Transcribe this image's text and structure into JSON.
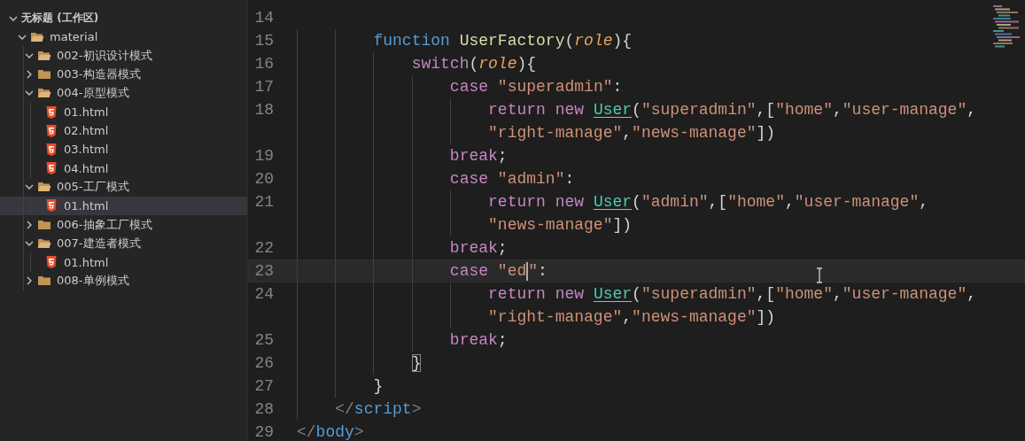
{
  "explorer": {
    "workspace": {
      "label": "无标题 (工作区)",
      "expanded": true,
      "children": [
        {
          "kind": "folder",
          "label": "material",
          "expanded": true,
          "selected": false,
          "children": [
            {
              "kind": "folder",
              "label": "002-初识设计模式",
              "expanded": true,
              "selected": false
            },
            {
              "kind": "folder",
              "label": "003-构造器模式",
              "expanded": false,
              "selected": false
            },
            {
              "kind": "folder",
              "label": "004-原型模式",
              "expanded": true,
              "selected": false,
              "children": [
                {
                  "kind": "file",
                  "label": "01.html",
                  "selected": false
                },
                {
                  "kind": "file",
                  "label": "02.html",
                  "selected": false
                },
                {
                  "kind": "file",
                  "label": "03.html",
                  "selected": false
                },
                {
                  "kind": "file",
                  "label": "04.html",
                  "selected": false
                }
              ]
            },
            {
              "kind": "folder",
              "label": "005-工厂模式",
              "expanded": true,
              "selected": false,
              "children": [
                {
                  "kind": "file",
                  "label": "01.html",
                  "selected": true
                }
              ]
            },
            {
              "kind": "folder",
              "label": "006-抽象工厂模式",
              "expanded": false,
              "selected": false
            },
            {
              "kind": "folder",
              "label": "007-建造者模式",
              "expanded": true,
              "selected": false,
              "children": [
                {
                  "kind": "file",
                  "label": "01.html",
                  "selected": false
                }
              ]
            },
            {
              "kind": "folder",
              "label": "008-单例模式",
              "expanded": false,
              "selected": false
            }
          ]
        }
      ]
    }
  },
  "editor": {
    "lines": [
      {
        "number": "14",
        "current": false,
        "rows": [
          {
            "tokens": []
          }
        ]
      },
      {
        "number": "15",
        "current": false,
        "rows": [
          {
            "tokens": [
              {
                "text": "        function ",
                "kind": "keyword"
              },
              {
                "text": "UserFactory",
                "kind": "function"
              },
              {
                "text": "(",
                "kind": "plain"
              },
              {
                "text": "role",
                "kind": "param"
              },
              {
                "text": "){",
                "kind": "plain"
              }
            ]
          }
        ]
      },
      {
        "number": "16",
        "current": false,
        "rows": [
          {
            "tokens": [
              {
                "text": "            switch",
                "kind": "control"
              },
              {
                "text": "(",
                "kind": "plain"
              },
              {
                "text": "role",
                "kind": "param"
              },
              {
                "text": "){",
                "kind": "plain"
              }
            ]
          }
        ]
      },
      {
        "number": "17",
        "current": false,
        "rows": [
          {
            "tokens": [
              {
                "text": "                case ",
                "kind": "control"
              },
              {
                "text": "\"superadmin\"",
                "kind": "string"
              },
              {
                "text": ":",
                "kind": "plain"
              }
            ]
          }
        ]
      },
      {
        "number": "18",
        "current": false,
        "rows": [
          {
            "tokens": [
              {
                "text": "                    return ",
                "kind": "control"
              },
              {
                "text": "new ",
                "kind": "control"
              },
              {
                "text": "User",
                "kind": "class"
              },
              {
                "text": "(",
                "kind": "plain"
              },
              {
                "text": "\"superadmin\"",
                "kind": "string"
              },
              {
                "text": ",[",
                "kind": "plain"
              },
              {
                "text": "\"home\"",
                "kind": "string"
              },
              {
                "text": ",",
                "kind": "plain"
              },
              {
                "text": "\"user-manage\"",
                "kind": "string"
              },
              {
                "text": ",",
                "kind": "plain"
              }
            ]
          },
          {
            "tokens": [
              {
                "text": "                    \"right-manage\"",
                "kind": "string"
              },
              {
                "text": ",",
                "kind": "plain"
              },
              {
                "text": "\"news-manage\"",
                "kind": "string"
              },
              {
                "text": "])",
                "kind": "plain"
              }
            ]
          }
        ]
      },
      {
        "number": "19",
        "current": false,
        "rows": [
          {
            "tokens": [
              {
                "text": "                break",
                "kind": "control"
              },
              {
                "text": ";",
                "kind": "plain"
              }
            ]
          }
        ]
      },
      {
        "number": "20",
        "current": false,
        "rows": [
          {
            "tokens": [
              {
                "text": "                case ",
                "kind": "control"
              },
              {
                "text": "\"admin\"",
                "kind": "string"
              },
              {
                "text": ":",
                "kind": "plain"
              }
            ]
          }
        ]
      },
      {
        "number": "21",
        "current": false,
        "rows": [
          {
            "tokens": [
              {
                "text": "                    return ",
                "kind": "control"
              },
              {
                "text": "new ",
                "kind": "control"
              },
              {
                "text": "User",
                "kind": "class"
              },
              {
                "text": "(",
                "kind": "plain"
              },
              {
                "text": "\"admin\"",
                "kind": "string"
              },
              {
                "text": ",[",
                "kind": "plain"
              },
              {
                "text": "\"home\"",
                "kind": "string"
              },
              {
                "text": ",",
                "kind": "plain"
              },
              {
                "text": "\"user-manage\"",
                "kind": "string"
              },
              {
                "text": ",",
                "kind": "plain"
              }
            ]
          },
          {
            "tokens": [
              {
                "text": "                    \"news-manage\"",
                "kind": "string"
              },
              {
                "text": "])",
                "kind": "plain"
              }
            ]
          }
        ]
      },
      {
        "number": "22",
        "current": false,
        "rows": [
          {
            "tokens": [
              {
                "text": "                break",
                "kind": "control"
              },
              {
                "text": ";",
                "kind": "plain"
              }
            ]
          }
        ]
      },
      {
        "number": "23",
        "current": true,
        "rows": [
          {
            "tokens": [
              {
                "text": "                case ",
                "kind": "control"
              },
              {
                "text": "\"ed",
                "kind": "string",
                "caret": true
              },
              {
                "text": "\"",
                "kind": "string"
              },
              {
                "text": ":",
                "kind": "plain"
              }
            ]
          }
        ]
      },
      {
        "number": "24",
        "current": false,
        "rows": [
          {
            "tokens": [
              {
                "text": "                    return ",
                "kind": "control"
              },
              {
                "text": "new ",
                "kind": "control"
              },
              {
                "text": "User",
                "kind": "class"
              },
              {
                "text": "(",
                "kind": "plain"
              },
              {
                "text": "\"superadmin\"",
                "kind": "string"
              },
              {
                "text": ",[",
                "kind": "plain"
              },
              {
                "text": "\"home\"",
                "kind": "string"
              },
              {
                "text": ",",
                "kind": "plain"
              },
              {
                "text": "\"user-manage\"",
                "kind": "string"
              },
              {
                "text": ",",
                "kind": "plain"
              }
            ]
          },
          {
            "tokens": [
              {
                "text": "                    \"right-manage\"",
                "kind": "string"
              },
              {
                "text": ",",
                "kind": "plain"
              },
              {
                "text": "\"news-manage\"",
                "kind": "string"
              },
              {
                "text": "])",
                "kind": "plain"
              }
            ]
          }
        ]
      },
      {
        "number": "25",
        "current": false,
        "rows": [
          {
            "tokens": [
              {
                "text": "                break",
                "kind": "control"
              },
              {
                "text": ";",
                "kind": "plain"
              }
            ]
          }
        ]
      },
      {
        "number": "26",
        "current": false,
        "rows": [
          {
            "tokens": [
              {
                "text": "            }",
                "kind": "bracket"
              }
            ]
          }
        ]
      },
      {
        "number": "27",
        "current": false,
        "rows": [
          {
            "tokens": [
              {
                "text": "        }",
                "kind": "plain"
              }
            ]
          }
        ]
      },
      {
        "number": "28",
        "current": false,
        "rows": [
          {
            "tokens": [
              {
                "text": "    </",
                "kind": "tag-bracket"
              },
              {
                "text": "script",
                "kind": "tag"
              },
              {
                "text": ">",
                "kind": "tag-bracket"
              }
            ]
          }
        ]
      },
      {
        "number": "29",
        "current": false,
        "rows": [
          {
            "tokens": [
              {
                "text": "</",
                "kind": "tag-bracket"
              },
              {
                "text": "body",
                "kind": "tag"
              },
              {
                "text": ">",
                "kind": "tag-bracket"
              }
            ]
          }
        ]
      }
    ]
  }
}
